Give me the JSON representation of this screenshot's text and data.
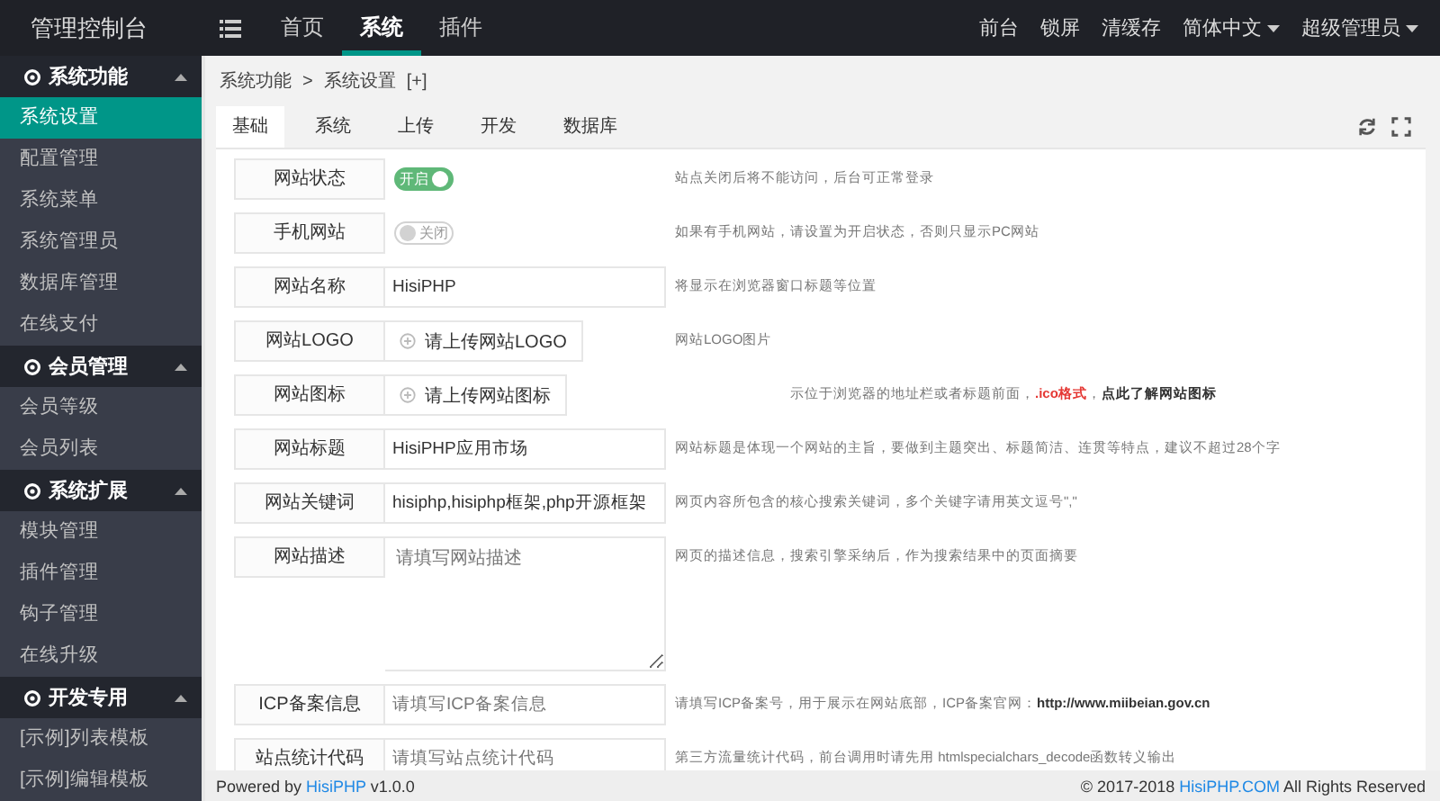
{
  "brand": "管理控制台",
  "top_nav": [
    {
      "label": "首页",
      "selected": false
    },
    {
      "label": "系统",
      "selected": true
    },
    {
      "label": "插件",
      "selected": false
    }
  ],
  "top_right": [
    {
      "label": "前台",
      "dropdown": false
    },
    {
      "label": "锁屏",
      "dropdown": false
    },
    {
      "label": "清缓存",
      "dropdown": false
    },
    {
      "label": "简体中文",
      "dropdown": true
    },
    {
      "label": "超级管理员",
      "dropdown": true
    }
  ],
  "sidebar": [
    {
      "title": "系统功能",
      "expanded": true,
      "items": [
        {
          "label": "系统设置",
          "selected": true
        },
        {
          "label": "配置管理",
          "selected": false
        },
        {
          "label": "系统菜单",
          "selected": false
        },
        {
          "label": "系统管理员",
          "selected": false
        },
        {
          "label": "数据库管理",
          "selected": false
        },
        {
          "label": "在线支付",
          "selected": false
        }
      ]
    },
    {
      "title": "会员管理",
      "expanded": true,
      "items": [
        {
          "label": "会员等级",
          "selected": false
        },
        {
          "label": "会员列表",
          "selected": false
        }
      ]
    },
    {
      "title": "系统扩展",
      "expanded": true,
      "items": [
        {
          "label": "模块管理",
          "selected": false
        },
        {
          "label": "插件管理",
          "selected": false
        },
        {
          "label": "钩子管理",
          "selected": false
        },
        {
          "label": "在线升级",
          "selected": false
        }
      ]
    },
    {
      "title": "开发专用",
      "expanded": true,
      "items": [
        {
          "label": "[示例]列表模板",
          "selected": false
        },
        {
          "label": "[示例]编辑模板",
          "selected": false
        }
      ]
    }
  ],
  "breadcrumb": [
    "系统功能",
    ">",
    "系统设置",
    "[+]"
  ],
  "tabs": [
    {
      "label": "基础",
      "selected": true
    },
    {
      "label": "系统",
      "selected": false
    },
    {
      "label": "上传",
      "selected": false
    },
    {
      "label": "开发",
      "selected": false
    },
    {
      "label": "数据库",
      "selected": false
    }
  ],
  "rows": [
    {
      "label": "网站状态",
      "kind": "switch",
      "on": true,
      "switch_text": "开启",
      "hint": [
        {
          "kind": "plain",
          "text": "站点关闭后将不能访问，后台可正常登录"
        }
      ]
    },
    {
      "label": "手机网站",
      "kind": "switch",
      "on": false,
      "switch_text": "关闭",
      "hint": [
        {
          "kind": "plain",
          "text": "如果有手机网站，请设置为开启状态，否则只显示PC网站"
        }
      ]
    },
    {
      "label": "网站名称",
      "kind": "text",
      "value": "HisiPHP",
      "hint": [
        {
          "kind": "plain",
          "text": "将显示在浏览器窗口标题等位置"
        }
      ]
    },
    {
      "label": "网站LOGO",
      "kind": "upload",
      "button": "请上传网站LOGO",
      "hint": [
        {
          "kind": "plain",
          "text": "网站LOGO图片"
        }
      ]
    },
    {
      "label": "网站图标",
      "kind": "upload",
      "button": "请上传网站图标",
      "hint": [
        {
          "kind": "plain",
          "text": "示位于浏览器的地址栏或者标题前面，"
        },
        {
          "kind": "warning",
          "text": ".ico格式"
        },
        {
          "kind": "plain",
          "text": "，"
        },
        {
          "kind": "link",
          "text": "点此了解网站图标"
        }
      ]
    },
    {
      "label": "网站标题",
      "kind": "text",
      "value": "HisiPHP应用市场",
      "hint": [
        {
          "kind": "plain",
          "text": "网站标题是体现一个网站的主旨，要做到主题突出、标题简洁、连贯等特点，建议不超过28个字"
        }
      ]
    },
    {
      "label": "网站关键词",
      "kind": "text",
      "value": "hisiphp,hisiphp框架,php开源框架",
      "hint": [
        {
          "kind": "plain",
          "text": "网页内容所包含的核心搜索关键词，多个关键字请用英文逗号\",\""
        }
      ]
    },
    {
      "label": "网站描述",
      "kind": "textarea",
      "placeholder": "请填写网站描述",
      "hint": [
        {
          "kind": "plain",
          "text": "网页的描述信息，搜索引擎采纳后，作为搜索结果中的页面摘要"
        }
      ]
    },
    {
      "label": "ICP备案信息",
      "kind": "text",
      "placeholder": "请填写ICP备案信息",
      "hint": [
        {
          "kind": "plain",
          "text": "请填写ICP备案号，用于展示在网站底部，ICP备案官网："
        },
        {
          "kind": "link",
          "text": "http://www.miibeian.gov.cn"
        }
      ]
    },
    {
      "label": "站点统计代码",
      "kind": "text",
      "placeholder": "请填写站点统计代码",
      "hint": [
        {
          "kind": "plain",
          "text": "第三方流量统计代码，前台调用时请先用 htmlspecialchars_decode函数转义输出"
        }
      ]
    }
  ],
  "footer": {
    "left": "Powered by",
    "left_link": "HisiPHP",
    "version": "v1.0.0",
    "right": "© 2017-2018",
    "right_link": "HisiPHP.COM",
    "right_tail": "All Rights Reserved"
  }
}
